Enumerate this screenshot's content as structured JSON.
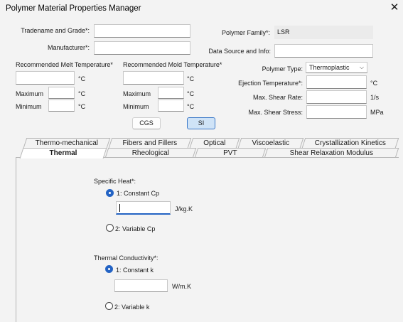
{
  "window": {
    "title": "Polymer Material Properties Manager",
    "close": "✕"
  },
  "header": {
    "tradename_label": "Tradename and Grade*:",
    "manufacturer_label": "Manufacturer*:",
    "polymer_family_label": "Polymer Family*:",
    "polymer_family_value": "LSR",
    "data_source_label": "Data Source and Info:",
    "melt_temp_label": "Recommended Melt Temperature*",
    "mold_temp_label": "Recommended Mold Temperature*",
    "maximum_label": "Maximum",
    "minimum_label": "Minimum",
    "unit_c": "°C",
    "polymer_type_label": "Polymer Type:",
    "polymer_type_value": "Thermoplastic",
    "ejection_temp_label": "Ejection Temperature*:",
    "ejection_unit": "°C",
    "max_shear_rate_label": "Max. Shear Rate:",
    "shear_rate_unit": "1/s",
    "max_shear_stress_label": "Max. Shear Stress:",
    "shear_stress_unit": "MPa"
  },
  "units": {
    "cgs_label": "CGS",
    "si_label": "SI",
    "selected": "SI"
  },
  "tabs_row1": [
    "Thermo-mechanical",
    "Fibers and Fillers",
    "Optical",
    "Viscoelastic",
    "Crystallization Kinetics"
  ],
  "tabs_row2": [
    "Thermal",
    "Rheological",
    "PVT",
    "Shear Relaxation Modulus"
  ],
  "active_tab": "Thermal",
  "thermal": {
    "specific_heat_label": "Specific Heat*:",
    "constant_cp_label": "1: Constant Cp",
    "cp_unit": "J/kg.K",
    "variable_cp_label": "2: Variable Cp",
    "thermal_conductivity_label": "Thermal Conductivity*:",
    "constant_k_label": "1: Constant k",
    "k_unit": "W/m.K",
    "variable_k_label": "2: Variable k"
  }
}
